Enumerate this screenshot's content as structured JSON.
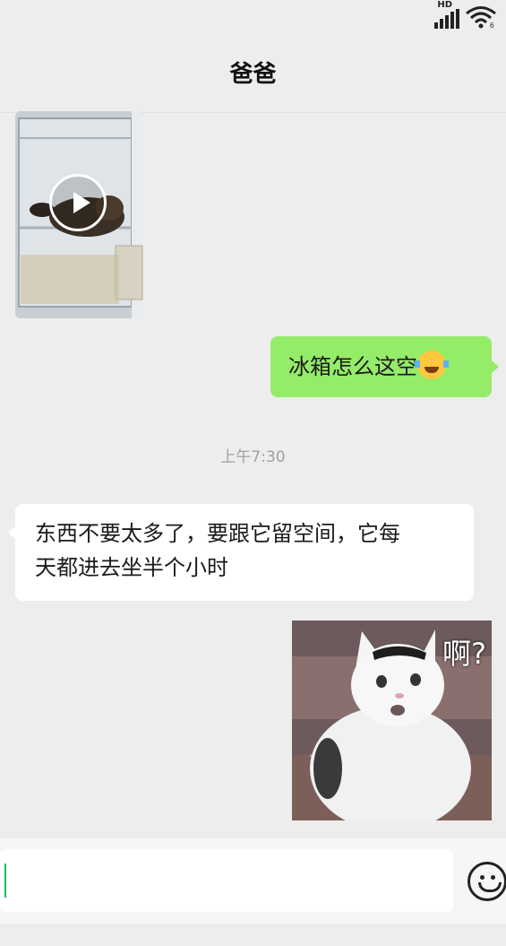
{
  "status_bar": {
    "network_label": "HD",
    "wifi_label": "6"
  },
  "header": {
    "title": "爸爸"
  },
  "messages": [
    {
      "type": "video",
      "from": "contact",
      "thumbnail": "cat-in-fridge"
    },
    {
      "type": "text",
      "from": "me",
      "text": "冰箱怎么这空",
      "emoji": "tears-of-joy"
    },
    {
      "type": "timestamp",
      "text": "上午7:30"
    },
    {
      "type": "text",
      "from": "contact",
      "line1": "东西不要太多了，要跟它留空间，它每",
      "line2": "天都进去坐半个小时"
    },
    {
      "type": "image",
      "from": "me",
      "caption": "啊?"
    }
  ],
  "input": {
    "value": "",
    "emoji_button": "smiley-icon"
  },
  "colors": {
    "background": "#ededed",
    "sent_bubble": "#95ec69",
    "received_bubble": "#ffffff",
    "cursor": "#07c160"
  }
}
